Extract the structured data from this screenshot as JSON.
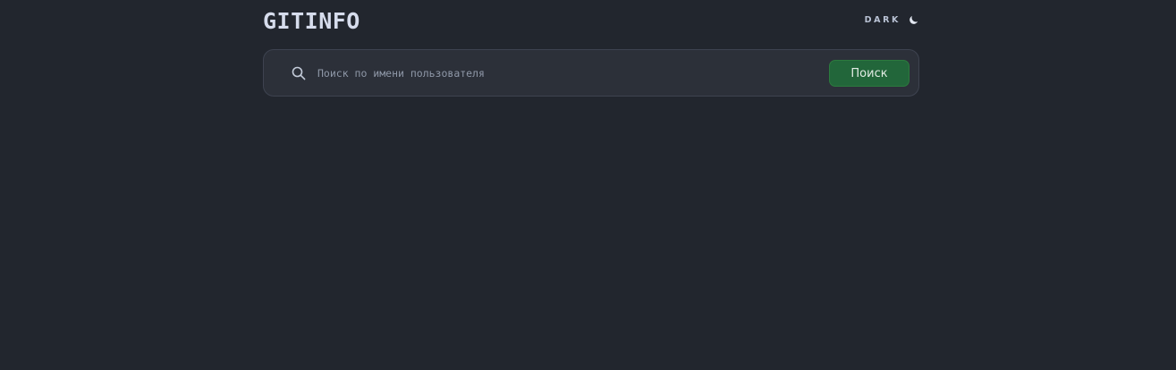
{
  "app": {
    "title": "GITINFO"
  },
  "header": {
    "theme_label": "DARK",
    "theme_icon": "moon-icon"
  },
  "search": {
    "placeholder": "Поиск по имени пользователя",
    "value": "",
    "button_label": "Поиск",
    "icon": "search-icon"
  },
  "colors": {
    "background": "#22262e",
    "card": "#2c3039",
    "accent_button": "#22663a",
    "logo_text": "#d6dcec"
  }
}
